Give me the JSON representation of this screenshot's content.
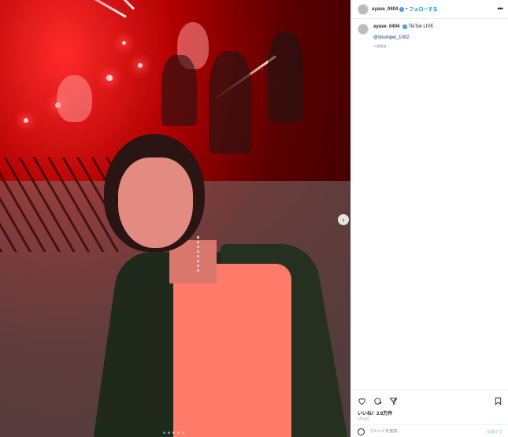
{
  "header": {
    "username": "ayase_0404",
    "separator": "•",
    "follow_label": "フォローする",
    "more_label": "•••"
  },
  "caption": {
    "username": "ayase_0404",
    "text": "TikTok LIVE",
    "mention": "@shumpei_1002",
    "time": "76週間前"
  },
  "media": {
    "next_label": "›",
    "carousel_count": 5,
    "carousel_active": 1
  },
  "actions": {
    "likes": "いいね！2.8万件",
    "date": "4月19日",
    "comment_placeholder": "コメントを追加...",
    "post_label": "投稿する"
  },
  "colors": {
    "accent": "#0095f6",
    "stage_red": "#b10000"
  },
  "icons": [
    "heart-icon",
    "comment-icon",
    "share-icon",
    "bookmark-icon",
    "emoji-icon",
    "verified-icon",
    "more-icon"
  ]
}
